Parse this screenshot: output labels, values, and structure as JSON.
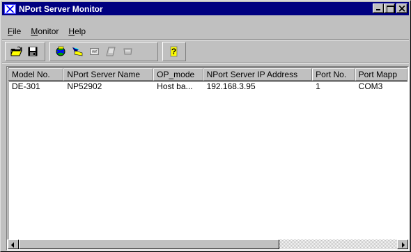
{
  "window": {
    "title": "NPort Server Monitor"
  },
  "menu": [
    {
      "label": "File",
      "key": "F",
      "rest": "ile"
    },
    {
      "label": "Monitor",
      "key": "M",
      "rest": "onitor"
    },
    {
      "label": "Help",
      "key": "H",
      "rest": "elp"
    }
  ],
  "toolbar": {
    "icons": [
      "open-folder-icon",
      "save-disk-icon",
      "search-globe-icon",
      "broadcast-search-icon",
      "monitor-icon",
      "script-icon",
      "serial-port-icon",
      "help-icon"
    ]
  },
  "table": {
    "headers": [
      "Model No.",
      "NPort Server Name",
      "OP_mode",
      "NPort Server IP Address",
      "Port No.",
      "Port Mapp"
    ],
    "rows": [
      [
        "DE-301",
        "NP52902",
        "Host ba...",
        "192.168.3.95",
        "1",
        "COM3"
      ]
    ]
  },
  "colors": {
    "titlebar": "#000080",
    "face": "#c0c0c0"
  }
}
